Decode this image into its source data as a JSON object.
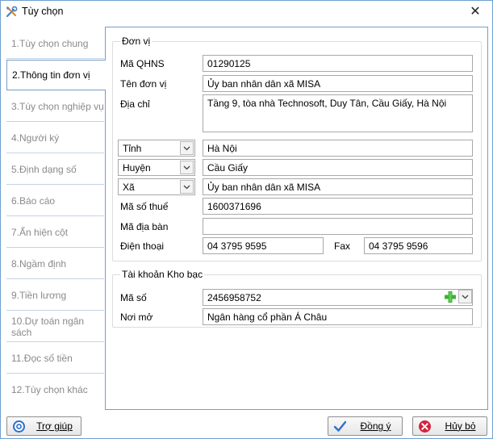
{
  "window": {
    "title": "Tùy chọn",
    "close_glyph": "✕"
  },
  "sidebar": {
    "tabs": [
      {
        "label": "1.Tùy chọn chung"
      },
      {
        "label": "2.Thông tin đơn vị"
      },
      {
        "label": "3.Tùy chọn nghiệp vụ"
      },
      {
        "label": "4.Người ký"
      },
      {
        "label": "5.Định dạng số"
      },
      {
        "label": "6.Báo cáo"
      },
      {
        "label": "7.Ẩn hiện cột"
      },
      {
        "label": "8.Ngầm định"
      },
      {
        "label": "9.Tiền lương"
      },
      {
        "label": "10.Dự toán ngân sách"
      },
      {
        "label": "11.Đọc số tiền"
      },
      {
        "label": "12.Tùy chọn khác"
      }
    ],
    "active_index": 1
  },
  "unit": {
    "group_title": "Đơn vị",
    "qhns_label": "Mã QHNS",
    "qhns_value": "01290125",
    "name_label": "Tên đơn vị",
    "name_value": "Ủy ban nhân dân xã MISA",
    "address_label": "Địa chỉ",
    "address_value": "Tầng 9, tòa nhà Technosoft, Duy Tân, Cầu Giấy, Hà Nội",
    "province_combo": "Tỉnh",
    "province_value": "Hà Nội",
    "district_combo": "Huyện",
    "district_value": "Cầu Giấy",
    "commune_combo": "Xã",
    "commune_value": "Ủy ban nhân dân xã MISA",
    "tax_label": "Mã số thuế",
    "tax_value": "1600371696",
    "area_label": "Mã địa bàn",
    "area_value": "",
    "phone_label": "Điện thoại",
    "phone_value": "04 3795 9595",
    "fax_label": "Fax",
    "fax_value": "04 3795 9596"
  },
  "treasury": {
    "group_title": "Tài khoản Kho bạc",
    "code_label": "Mã số",
    "code_value": "2456958752",
    "place_label": "Nơi mở",
    "place_value": "Ngân hàng cổ phần Á Châu"
  },
  "footer": {
    "help_label": "Trợ giúp",
    "ok_label": "Đồng ý",
    "cancel_label": "Hủy bỏ"
  },
  "colors": {
    "accent_border": "#7a9cc4",
    "add_icon": "#3fae3a",
    "ok_icon": "#2d6fcf",
    "cancel_icon": "#d6223a"
  }
}
